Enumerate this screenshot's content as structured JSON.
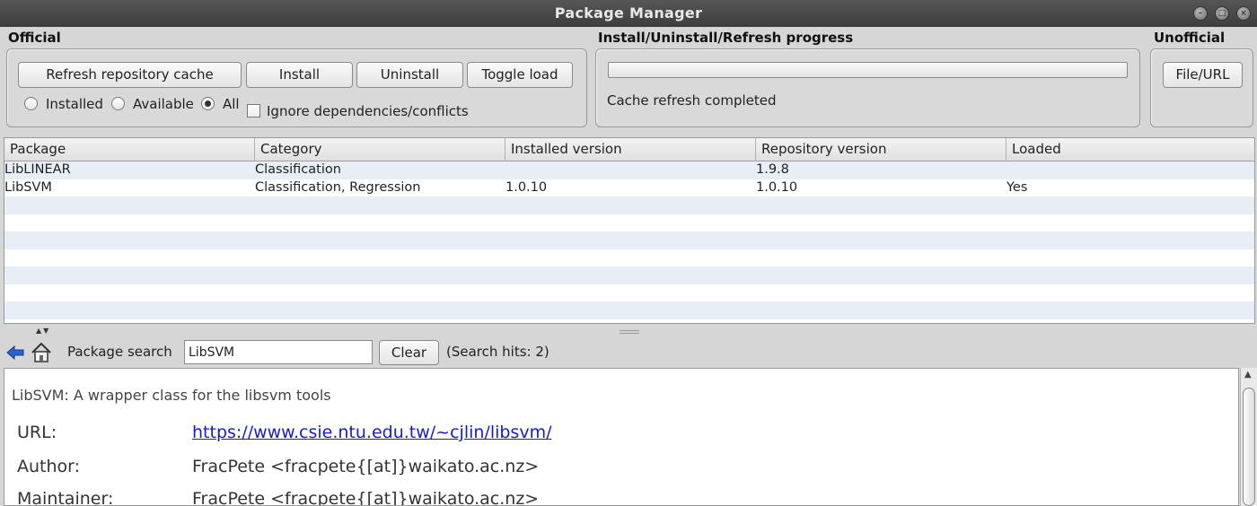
{
  "window": {
    "title": "Package Manager"
  },
  "official": {
    "label": "Official",
    "buttons": {
      "refresh": "Refresh repository cache",
      "install": "Install",
      "uninstall": "Uninstall",
      "toggle": "Toggle load"
    },
    "filters": {
      "installed": "Installed",
      "available": "Available",
      "all": "All",
      "selected": "All"
    },
    "ignore_dependencies": {
      "label": "Ignore dependencies/conflicts",
      "checked": false
    }
  },
  "progress": {
    "label": "Install/Uninstall/Refresh progress",
    "status": "Cache refresh completed",
    "value": 0
  },
  "unofficial": {
    "label": "Unofficial",
    "button": "File/URL"
  },
  "table": {
    "columns": [
      "Package",
      "Category",
      "Installed version",
      "Repository version",
      "Loaded"
    ],
    "rows": [
      {
        "package": "LibLINEAR",
        "category": "Classification",
        "installed": "",
        "repository": "1.9.8",
        "loaded": ""
      },
      {
        "package": "LibSVM",
        "category": "Classification, Regression",
        "installed": "1.0.10",
        "repository": "1.0.10",
        "loaded": "Yes"
      }
    ]
  },
  "search": {
    "label": "Package search",
    "value": "LibSVM",
    "clear": "Clear",
    "hits": "(Search hits: 2)"
  },
  "info": {
    "summary": "LibSVM: A wrapper class for the libsvm tools",
    "url_label": "URL:",
    "url": "https://www.csie.ntu.edu.tw/~cjlin/libsvm/",
    "author_label": "Author:",
    "author": "FracPete <fracpete{[at]}waikato.ac.nz>",
    "maintainer_label": "Maintainer:",
    "maintainer": "FracPete <fracpete{[at]}waikato.ac.nz>"
  },
  "icons": {
    "back": "back-arrow-icon",
    "home": "home-icon"
  }
}
